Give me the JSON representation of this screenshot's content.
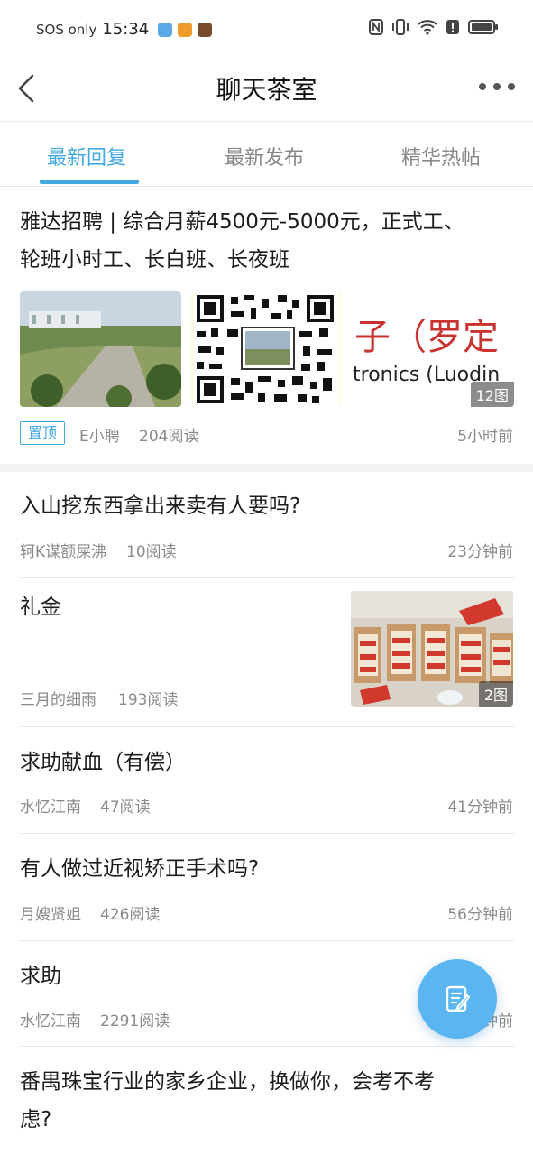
{
  "status_bar": {
    "carrier": "SOS only",
    "time": "15:34"
  },
  "header": {
    "title": "聊天茶室"
  },
  "tabs": [
    {
      "label": "最新回复",
      "active": true
    },
    {
      "label": "最新发布",
      "active": false
    },
    {
      "label": "精华热帖",
      "active": false
    }
  ],
  "posts": [
    {
      "title_line1": "雅达招聘 | 综合月薪4500元-5000元，正式工、",
      "title_line2": "轮班小时工、长白班、长夜班",
      "pinned": "置顶",
      "author": "E小聘",
      "reads": "204阅读",
      "time": "5小时前",
      "banner_text_cn": "子（罗定",
      "banner_text_en": "tronics (Luodin",
      "image_count": "12图"
    },
    {
      "title": "入山挖东西拿出来卖有人要吗?",
      "author": "轲K谋额屎沸",
      "reads": "10阅读",
      "time": "23分钟前"
    },
    {
      "title": "礼金",
      "author": "三月的细雨",
      "reads": "193阅读",
      "time": "",
      "image_count": "2图"
    },
    {
      "title": "求助献血（有偿）",
      "author": "水忆江南",
      "reads": "47阅读",
      "time": "41分钟前"
    },
    {
      "title": "有人做过近视矫正手术吗?",
      "author": "月嫂贤姐",
      "reads": "426阅读",
      "time": "56分钟前"
    },
    {
      "title": "求助",
      "author": "水忆江南",
      "reads": "2291阅读",
      "time": "钟前"
    },
    {
      "title_line1": "番禺珠宝行业的家乡企业，换做你，会考不考",
      "title_line2": "虑?"
    }
  ],
  "colors": {
    "accent": "#43a9e3",
    "fab": "#5bb5f0"
  },
  "icons": {
    "back": "chevron-left-icon",
    "more": "more-dots-icon",
    "fab": "edit-post-icon"
  }
}
